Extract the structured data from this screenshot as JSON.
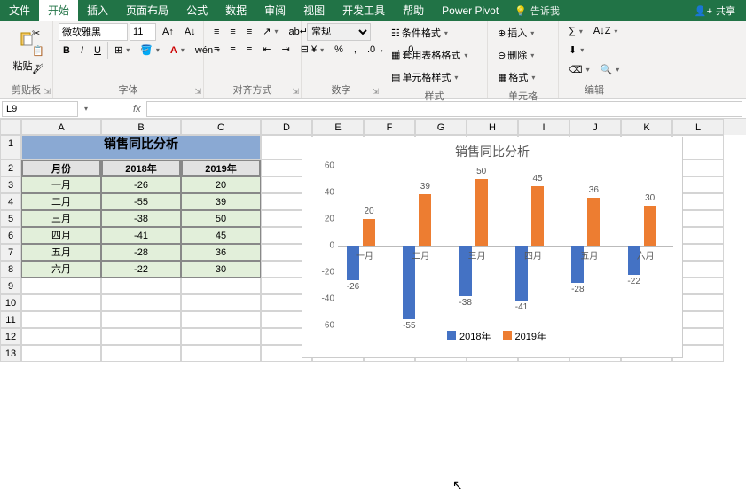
{
  "tabs": {
    "file": "文件",
    "home": "开始",
    "insert": "插入",
    "layout": "页面布局",
    "formula": "公式",
    "data": "数据",
    "review": "审阅",
    "view": "视图",
    "dev": "开发工具",
    "help": "帮助",
    "pivot": "Power Pivot",
    "tellme": "告诉我",
    "share": "共享"
  },
  "ribbon": {
    "paste": "粘贴",
    "clipboard": "剪贴板",
    "font": "字体",
    "align": "对齐方式",
    "number": "数字",
    "styles": "样式",
    "cells": "单元格",
    "editing": "编辑",
    "fontname": "微软雅黑",
    "fontsize": "11",
    "numberfmt": "常规",
    "condfmt": "条件格式",
    "tablefmt": "套用表格格式",
    "cellstyle": "单元格样式",
    "insert": "插入",
    "delete": "删除",
    "format": "格式"
  },
  "namebox": "L9",
  "table": {
    "title": "销售同比分析",
    "headers": {
      "month": "月份",
      "y2018": "2018年",
      "y2019": "2019年"
    },
    "rows": [
      {
        "month": "一月",
        "y2018": -26,
        "y2019": 20
      },
      {
        "month": "二月",
        "y2018": -55,
        "y2019": 39
      },
      {
        "month": "三月",
        "y2018": -38,
        "y2019": 50
      },
      {
        "month": "四月",
        "y2018": -41,
        "y2019": 45
      },
      {
        "month": "五月",
        "y2018": -28,
        "y2019": 36
      },
      {
        "month": "六月",
        "y2018": -22,
        "y2019": 30
      }
    ]
  },
  "columns": [
    "A",
    "B",
    "C",
    "D",
    "E",
    "F",
    "G",
    "H",
    "I",
    "J",
    "K",
    "L"
  ],
  "rownums": [
    "1",
    "2",
    "3",
    "4",
    "5",
    "6",
    "7",
    "8",
    "9",
    "10",
    "11",
    "12",
    "13"
  ],
  "chart_data": {
    "type": "bar",
    "title": "销售同比分析",
    "categories": [
      "一月",
      "二月",
      "三月",
      "四月",
      "五月",
      "六月"
    ],
    "series": [
      {
        "name": "2018年",
        "values": [
          -26,
          -55,
          -38,
          -41,
          -28,
          -22
        ],
        "color": "#4472c4"
      },
      {
        "name": "2019年",
        "values": [
          20,
          39,
          50,
          45,
          36,
          30
        ],
        "color": "#ed7d31"
      }
    ],
    "ylim": [
      -60,
      60
    ],
    "yticks": [
      -60,
      -40,
      -20,
      0,
      20,
      40,
      60
    ]
  }
}
